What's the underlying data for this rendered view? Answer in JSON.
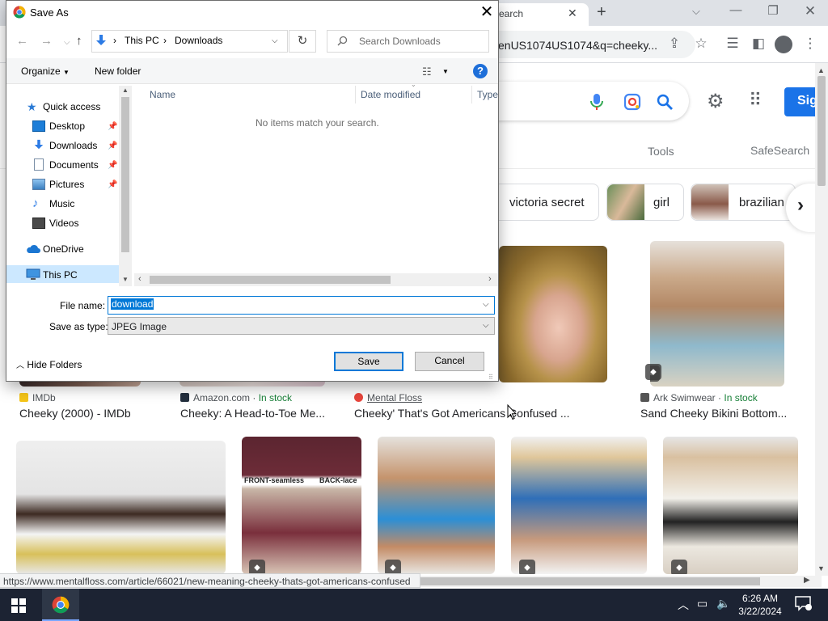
{
  "chrome": {
    "tab_title": "earch",
    "address_text": "enUS1074US1074&q=cheeky...",
    "colors": {
      "tabstrip": "#dee1e6",
      "accent": "#1a73e8"
    }
  },
  "google": {
    "signin_label": "Sig",
    "tools_label": "Tools",
    "safesearch_label": "SafeSearch",
    "chips": [
      {
        "label": "victoria secret"
      },
      {
        "label": "girl"
      },
      {
        "label": "brazilian"
      }
    ],
    "results": [
      {
        "source": "IMDb",
        "stock": "",
        "title": "Cheeky (2000) - IMDb"
      },
      {
        "source": "Amazon.com",
        "stock": "In stock",
        "title": "Cheeky: A Head-to-Toe Me..."
      },
      {
        "source": "Mental Floss",
        "stock": "",
        "title": "Cheeky' That's Got Americans Confused ..."
      },
      {
        "source": "Ark Swimwear",
        "stock": "In stock",
        "title": "Sand Cheeky Bikini Bottom..."
      }
    ],
    "second_row_labels": {
      "front": "FRONT-seamless",
      "back": "BACK-lace"
    },
    "status_url": "https://www.mentalfloss.com/article/66021/new-meaning-cheeky-thats-got-americans-confused"
  },
  "dialog": {
    "title": "Save As",
    "breadcrumb": [
      "This PC",
      "Downloads"
    ],
    "search_placeholder": "Search Downloads",
    "organize_label": "Organize",
    "new_folder_label": "New folder",
    "nav_items": [
      {
        "label": "Quick access",
        "icon": "star-icon"
      },
      {
        "label": "Desktop",
        "icon": "desktop-icon",
        "pinned": true
      },
      {
        "label": "Downloads",
        "icon": "download-arrow-icon",
        "pinned": true
      },
      {
        "label": "Documents",
        "icon": "document-icon",
        "pinned": true
      },
      {
        "label": "Pictures",
        "icon": "pictures-icon",
        "pinned": true
      },
      {
        "label": "Music",
        "icon": "music-icon"
      },
      {
        "label": "Videos",
        "icon": "video-icon"
      },
      {
        "label": "OneDrive",
        "icon": "cloud-icon"
      },
      {
        "label": "This PC",
        "icon": "computer-icon",
        "selected": true
      }
    ],
    "columns": [
      "Name",
      "Date modified",
      "Type"
    ],
    "empty_message": "No items match your search.",
    "file_name_label": "File name:",
    "file_name_value": "download",
    "save_type_label": "Save as type:",
    "save_type_value": "JPEG Image",
    "hide_folders_label": "Hide Folders",
    "save_label": "Save",
    "cancel_label": "Cancel"
  },
  "taskbar": {
    "time": "6:26 AM",
    "date": "3/22/2024"
  }
}
